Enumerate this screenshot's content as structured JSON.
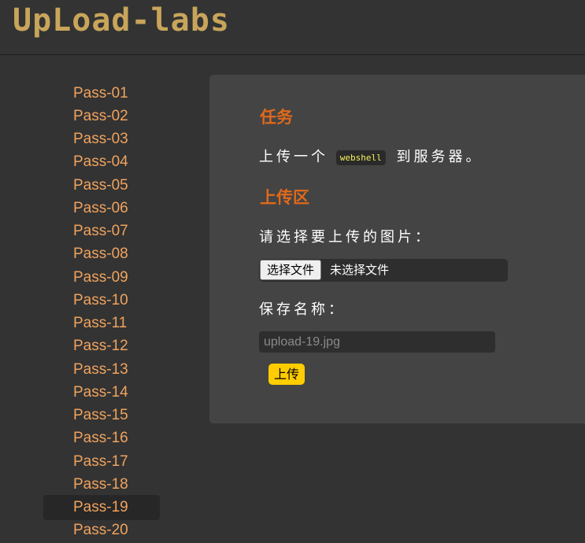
{
  "header": {
    "logo_text": "UpLoad-labs"
  },
  "sidebar": {
    "active": "Pass-19",
    "items": [
      {
        "label": "Pass-01"
      },
      {
        "label": "Pass-02"
      },
      {
        "label": "Pass-03"
      },
      {
        "label": "Pass-04"
      },
      {
        "label": "Pass-05"
      },
      {
        "label": "Pass-06"
      },
      {
        "label": "Pass-07"
      },
      {
        "label": "Pass-08"
      },
      {
        "label": "Pass-09"
      },
      {
        "label": "Pass-10"
      },
      {
        "label": "Pass-11"
      },
      {
        "label": "Pass-12"
      },
      {
        "label": "Pass-13"
      },
      {
        "label": "Pass-14"
      },
      {
        "label": "Pass-15"
      },
      {
        "label": "Pass-16"
      },
      {
        "label": "Pass-17"
      },
      {
        "label": "Pass-18"
      },
      {
        "label": "Pass-19"
      },
      {
        "label": "Pass-20"
      }
    ]
  },
  "task": {
    "heading": "任务",
    "text_before": "上传一个",
    "code": "webshell",
    "text_after": "到服务器。"
  },
  "upload": {
    "heading": "上传区",
    "file_prompt": "请选择要上传的图片：",
    "file_button": "选择文件",
    "file_status": "未选择文件",
    "save_name_label": "保存名称：",
    "save_name_placeholder": "upload-19.jpg",
    "submit_label": "上传"
  },
  "colors": {
    "background": "#333333",
    "panel": "#444444",
    "link": "#f0a35e",
    "heading": "#e0691b",
    "logo": "#c8a55a",
    "code_text": "#f5f05a",
    "submit": "#ffcc00"
  }
}
